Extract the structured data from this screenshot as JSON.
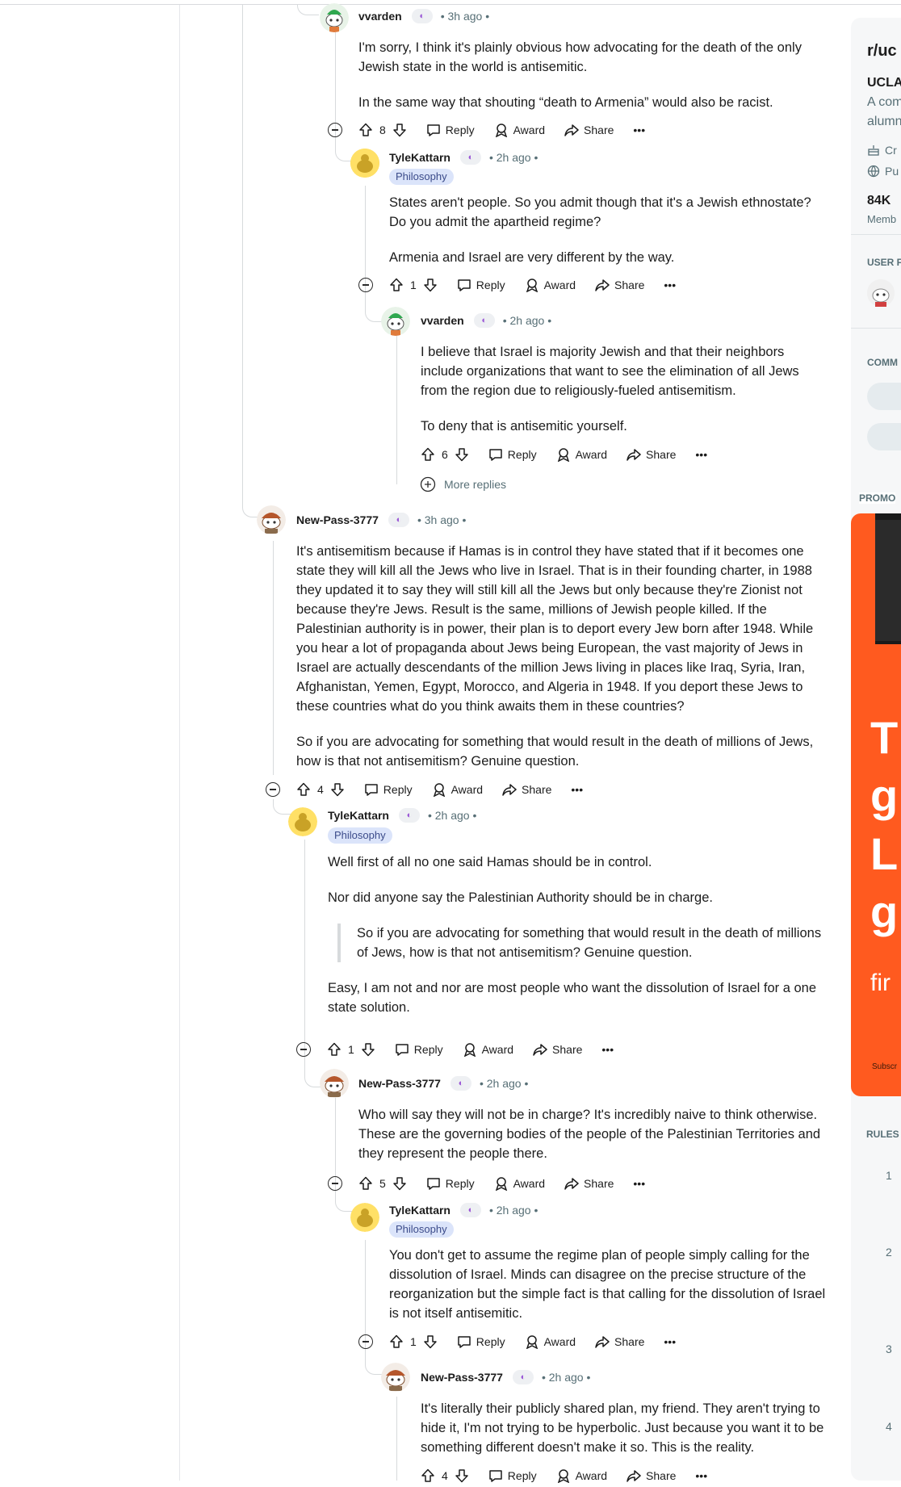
{
  "comments": [
    {
      "author": "vvarden",
      "time": "• 3h ago •",
      "paragraphs": [
        "I'm sorry, I think it's plainly obvious how advocating for the death of the only Jewish state in the world is antisemitic.",
        "In the same way that shouting “death to Armenia” would also be racist."
      ],
      "votes": "8"
    },
    {
      "author": "TyleKattarn",
      "flair": "Philosophy",
      "time": "• 2h ago •",
      "paragraphs": [
        "States aren't people. So you admit though that it's a Jewish ethnostate? Do you admit the apartheid regime?",
        "Armenia and Israel are very different by the way."
      ],
      "votes": "1"
    },
    {
      "author": "vvarden",
      "time": "• 2h ago •",
      "paragraphs": [
        "I believe that Israel is majority Jewish and that their neighbors include organizations that want to see the elimination of all Jews from the region due to religiously-fueled antisemitism.",
        "To deny that is antisemitic yourself."
      ],
      "votes": "6"
    },
    {
      "author": "New-Pass-3777",
      "time": "• 3h ago •",
      "paragraphs": [
        "It's antisemitism because if Hamas is in control they have stated that if it becomes one state they will kill all the Jews who live in Israel. That is in their founding charter, in 1988 they updated it to say they will still kill all the Jews but only because they're Zionist not because they're Jews. Result is the same, millions of Jewish people killed. If the Palestinian authority is in power, their plan is to deport every Jew born after 1948. While you hear a lot of propaganda about Jews being European, the vast majority of Jews in Israel are actually descendants of the million Jews living in places like Iraq, Syria, Iran, Afghanistan, Yemen, Egypt, Morocco, and Algeria in 1948. If you deport these Jews to these countries what do you think awaits them in these countries?",
        "So if you are advocating for something that would result in the death of millions of Jews, how is that not antisemitism? Genuine question."
      ],
      "votes": "4"
    },
    {
      "author": "TyleKattarn",
      "flair": "Philosophy",
      "time": "• 2h ago •",
      "paragraphs": [
        "Well first of all no one said Hamas should be in control.",
        "Nor did anyone say the Palestinian Authority should be in charge."
      ],
      "quote": "So if you are advocating for something that would result in the death of millions of Jews, how is that not antisemitism? Genuine question.",
      "paragraphs_after": [
        "Easy, I am not and nor are most people who want the dissolution of Israel for a one state solution."
      ],
      "votes": "1"
    },
    {
      "author": "New-Pass-3777",
      "time": "• 2h ago •",
      "paragraphs": [
        "Who will say they will not be in charge? It's incredibly naive to think otherwise. These are the governing bodies of the people of the Palestinian Territories and they represent the people there."
      ],
      "votes": "5"
    },
    {
      "author": "TyleKattarn",
      "flair": "Philosophy",
      "time": "• 2h ago •",
      "paragraphs": [
        "You don't get to assume the regime plan of people simply calling for the dissolution of Israel. Minds can disagree on the precise structure of the reorganization but the simple fact is that calling for the dissolution of Israel is not itself antisemitic."
      ],
      "votes": "1"
    },
    {
      "author": "New-Pass-3777",
      "time": "• 2h ago •",
      "paragraphs": [
        "It's literally their publicly shared plan, my friend. They aren't trying to hide it, I'm not trying to be hyperbolic. Just because you want it to be something different doesn't make it so. This is the reality."
      ],
      "votes": "4"
    }
  ],
  "actions": {
    "reply": "Reply",
    "award": "Award",
    "share": "Share",
    "more": "•••"
  },
  "more_replies": "More replies",
  "sidebar": {
    "community": "r/uc",
    "name": "UCLA",
    "desc_1": "A com",
    "desc_2": "alumn",
    "row_1": "Cr",
    "row_2": "Pu",
    "members_count": "84K",
    "members_label": "Memb",
    "user_flair": "USER F",
    "community_bookmarks": "COMM",
    "promoted": "PROMO",
    "rules": "RULES",
    "rule_numbers": [
      "1",
      "2",
      "3",
      "4"
    ],
    "promo_letters": [
      "T",
      "g",
      "Li",
      "g"
    ],
    "promo_brand": "fir",
    "promo_sub": "Subscr"
  },
  "colors": {
    "accent": "#ff4500",
    "meta": "#576f76",
    "flair_bg": "#dbe4fa"
  }
}
